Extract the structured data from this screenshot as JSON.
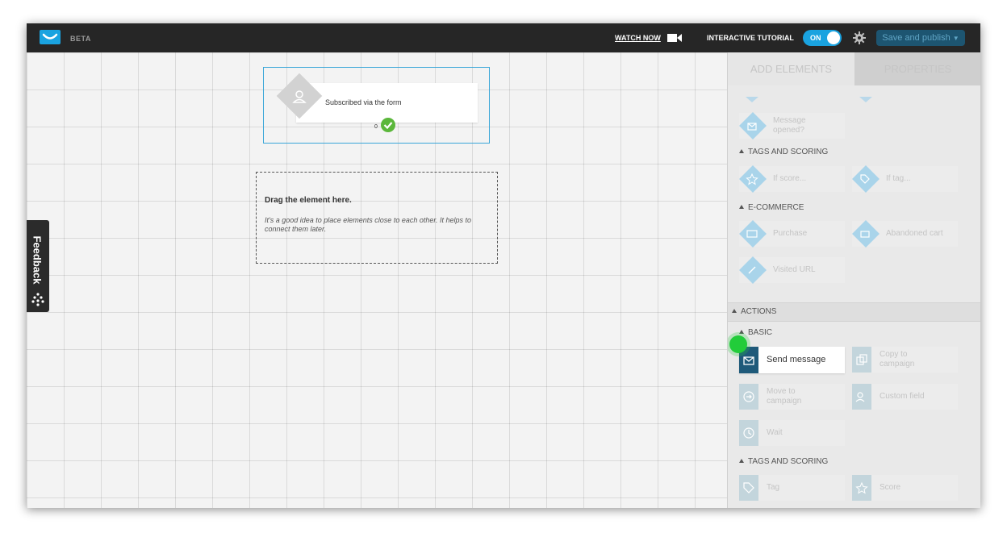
{
  "topbar": {
    "beta": "BETA",
    "watch_now": "WATCH NOW",
    "tutorial_label": "INTERACTIVE TUTORIAL",
    "toggle_state": "ON",
    "publish_label": "Save and publish",
    "brand_color": "#1aa3e0"
  },
  "canvas": {
    "node": {
      "label": "Subscribed via the form",
      "count": "0"
    },
    "dropzone": {
      "title": "Drag the element here.",
      "hint": "It's a good idea to place elements close to each other. It helps to connect them later."
    }
  },
  "feedback": {
    "label": "Feedback"
  },
  "panel": {
    "tabs": {
      "add": "ADD ELEMENTS",
      "properties": "PROPERTIES"
    },
    "conditions": {
      "message_opened": "Message opened?",
      "tags_scoring_header": "TAGS AND SCORING",
      "if_score": "If score...",
      "if_tag": "If tag...",
      "ecommerce_header": "E-COMMERCE",
      "purchase": "Purchase",
      "abandoned_cart": "Abandoned cart",
      "visited_url": "Visited URL"
    },
    "actions": {
      "header": "ACTIONS",
      "basic_header": "BASIC",
      "send_message": "Send message",
      "copy_to_campaign": "Copy to campaign",
      "move_to_campaign": "Move to campaign",
      "custom_field": "Custom field",
      "wait": "Wait",
      "tags_scoring_header": "TAGS AND SCORING",
      "tag": "Tag",
      "score": "Score"
    }
  }
}
